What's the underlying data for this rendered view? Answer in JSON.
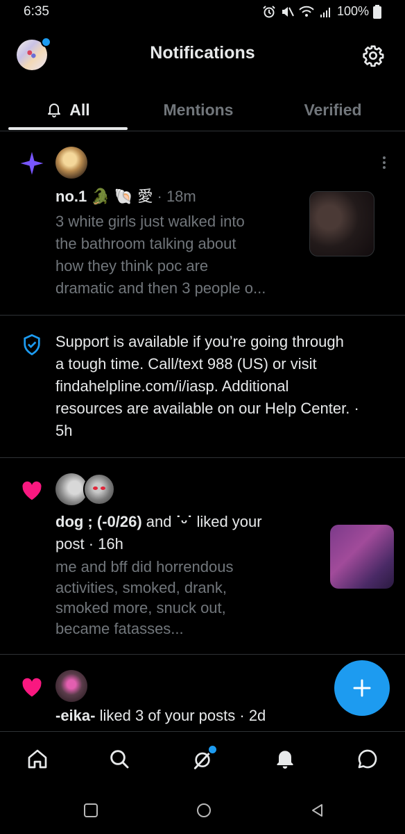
{
  "status_bar": {
    "time": "6:35",
    "battery": "100%",
    "icons": [
      "alarm-icon",
      "mute-icon",
      "wifi-icon",
      "signal-icon",
      "battery-icon"
    ]
  },
  "header": {
    "title": "Notifications",
    "settings_icon": "gear-icon"
  },
  "tabs": [
    {
      "label": "All",
      "active": true,
      "icon": "bell-icon"
    },
    {
      "label": "Mentions",
      "active": false
    },
    {
      "label": "Verified",
      "active": false
    }
  ],
  "notifications": [
    {
      "type": "recommended-post",
      "icon": "sparkle-icon",
      "author": "no.1",
      "emoji": "🐊 🐚 愛",
      "meta": "· 18m",
      "preview_lines": [
        "3 white girls just walked into",
        "the bathroom talking about",
        "how they think poc are",
        "dramatic and then 3 people o..."
      ],
      "more_icon": "more-vertical-icon"
    },
    {
      "type": "safety",
      "icon": "shield-check-icon",
      "lines": [
        "Support is available if you’re going through",
        "a tough time. Call/text 988 (US) or visit",
        "findahelpline.com/i/iasp. Additional",
        "resources are available on our Help Center. ·",
        "5h"
      ]
    },
    {
      "type": "like",
      "icon": "heart-icon",
      "line1_bold": "dog ; (-0/26)",
      "line1_rest": "and",
      "line1_name2": "˙ᵕ˙",
      "line1_end": "liked your",
      "line2": "post · 16h",
      "preview_lines": [
        "me and bff did horrendous",
        "activities, smoked, drank,",
        "smoked more, snuck out,",
        "became fatasses..."
      ]
    },
    {
      "type": "like",
      "icon": "heart-icon",
      "bold": "-eika-",
      "rest": "liked 3 of your posts · 2d"
    }
  ],
  "fab": {
    "icon": "plus-icon"
  },
  "bottom_nav": [
    "home-icon",
    "search-icon",
    "grok-icon",
    "bell-icon",
    "messages-icon"
  ],
  "system_nav": [
    "recents-icon",
    "home-circle-icon",
    "back-icon"
  ],
  "colors": {
    "background": "#000000",
    "text": "#e7e9ea",
    "muted": "#71767b",
    "accent": "#1d9bf0",
    "heart": "#f91880",
    "sparkle": "#7856ff"
  }
}
